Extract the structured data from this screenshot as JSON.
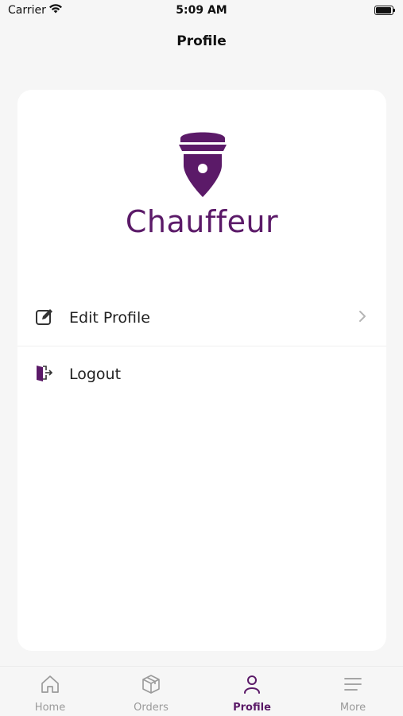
{
  "status_bar": {
    "carrier": "Carrier",
    "time": "5:09 AM"
  },
  "header": {
    "title": "Profile"
  },
  "brand": {
    "name": "Chauffeur",
    "color": "#5b1a68"
  },
  "menu": {
    "items": [
      {
        "label": "Edit Profile",
        "icon": "edit-icon",
        "has_chevron": true
      },
      {
        "label": "Logout",
        "icon": "logout-icon",
        "has_chevron": false
      }
    ]
  },
  "tab_bar": {
    "active": "Profile",
    "accent": "#5b1a68",
    "inactive_color": "#9a9a9a",
    "tabs": [
      {
        "label": "Home",
        "icon": "home-icon"
      },
      {
        "label": "Orders",
        "icon": "box-icon"
      },
      {
        "label": "Profile",
        "icon": "person-icon"
      },
      {
        "label": "More",
        "icon": "menu-icon"
      }
    ]
  }
}
